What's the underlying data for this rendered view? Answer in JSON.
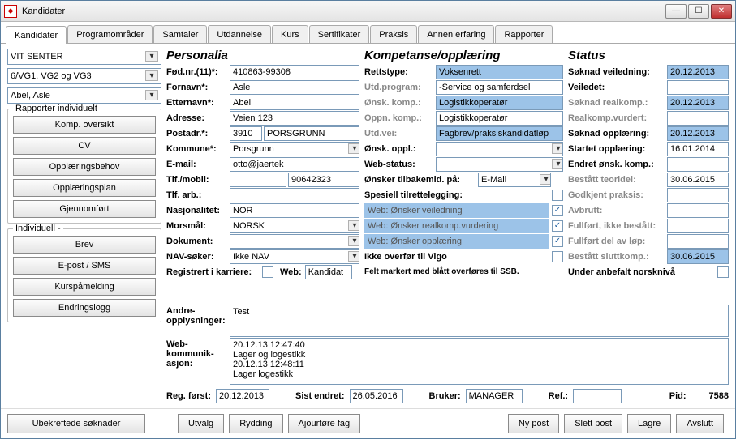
{
  "window": {
    "title": "Kandidater"
  },
  "tabs": [
    "Kandidater",
    "Programområder",
    "Samtaler",
    "Utdannelse",
    "Kurs",
    "Sertifikater",
    "Praksis",
    "Annen erfaring",
    "Rapporter"
  ],
  "active_tab": 0,
  "selectors": {
    "senter": "VIT SENTER",
    "level": "6/VG1, VG2 og VG3",
    "person": "Abel, Asle"
  },
  "group_rapporter": {
    "title": "Rapporter individuelt",
    "buttons": [
      "Komp. oversikt",
      "CV",
      "Opplæringsbehov",
      "Opplæringsplan",
      "Gjennomført"
    ]
  },
  "group_individ": {
    "title": "Individuell -",
    "buttons": [
      "Brev",
      "E-post / SMS",
      "Kurspåmelding",
      "Endringslogg"
    ]
  },
  "left_extra_btn": "Ubekreftede søknader",
  "personalia": {
    "heading": "Personalia",
    "rows": [
      {
        "label": "Fød.nr.(11)*:",
        "value": "410863-99308",
        "type": "inp"
      },
      {
        "label": "Fornavn*:",
        "value": "Asle",
        "type": "inp"
      },
      {
        "label": "Etternavn*:",
        "value": "Abel",
        "type": "inp"
      },
      {
        "label": "Adresse:",
        "value": "Veien 123",
        "type": "inp"
      },
      {
        "label": "Postadr.*:",
        "value": "3910",
        "value2": "PORSGRUNN",
        "type": "post"
      },
      {
        "label": "Kommune*:",
        "value": "Porsgrunn",
        "type": "sel"
      },
      {
        "label": "E-mail:",
        "value": "otto@jaertek",
        "type": "inp"
      },
      {
        "label": "Tlf./mobil:",
        "value": "",
        "value2": "90642323",
        "type": "tlf"
      },
      {
        "label": "Tlf. arb.:",
        "value": "",
        "type": "inp"
      },
      {
        "label": "Nasjonalitet:",
        "value": "NOR",
        "type": "inp"
      },
      {
        "label": "Morsmål:",
        "value": "NORSK",
        "type": "sel"
      },
      {
        "label": "Dokument:",
        "value": "",
        "type": "sel"
      },
      {
        "label": "NAV-søker:",
        "value": "Ikke NAV",
        "type": "sel"
      }
    ],
    "registrert_label": "Registrert i karriere:",
    "web_label": "Web:",
    "web_value": "Kandidat",
    "andre_label": "Andre-\nopplysninger:",
    "andre_value": "Test",
    "webkom_label": "Web-\nkommunik-\nasjon:",
    "webkom_value": "20.12.13 12:47:40\nLager og logestikk\n20.12.13 12:48:11\nLager logestikk",
    "reg_forst_label": "Reg. først:",
    "reg_forst": "20.12.2013",
    "sist_endret_label": "Sist endret:",
    "sist_endret": "26.05.2016",
    "bruker_label": "Bruker:",
    "bruker": "MANAGER",
    "ref_label": "Ref.:",
    "ref": "",
    "pid_label": "Pid:",
    "pid": "7588"
  },
  "kompetanse": {
    "heading": "Kompetanse/opplæring",
    "rows": [
      {
        "label": "Rettstype:",
        "value": "Voksenrett",
        "gray": false,
        "blue": true,
        "type": "txt"
      },
      {
        "label": "Utd.program:",
        "value": "-Service og samferdsel",
        "gray": true,
        "blue": false,
        "type": "txt"
      },
      {
        "label": "Ønsk. komp.:",
        "value": "Logistikkoperatør",
        "gray": true,
        "blue": true,
        "type": "txt"
      },
      {
        "label": "Oppn. komp.:",
        "value": "Logistikkoperatør",
        "gray": true,
        "blue": false,
        "type": "txt"
      },
      {
        "label": "Utd.vei:",
        "value": "Fagbrev/praksiskandidatløp",
        "gray": true,
        "blue": true,
        "type": "txt"
      },
      {
        "label": "Ønsk. oppl.:",
        "value": "",
        "gray": false,
        "blue": false,
        "type": "sel"
      },
      {
        "label": "Web-status:",
        "value": "",
        "gray": false,
        "blue": false,
        "type": "sel"
      }
    ],
    "tilbake_label": "Ønsker tilbakemld. på:",
    "tilbake_value": "E-Mail",
    "spesiell_label": "Spesiell tilrettelegging:",
    "web_rows": [
      {
        "label": "Web: Ønsker veiledning",
        "checked": true
      },
      {
        "label": "Web: Ønsker realkomp.vurdering",
        "checked": true
      },
      {
        "label": "Web: Ønsker opplæring",
        "checked": true
      }
    ],
    "vigo_label": "Ikke overfør til Vigo",
    "ssb_note": "Felt markert med blått overføres til SSB."
  },
  "status": {
    "heading": "Status",
    "rows": [
      {
        "label": "Søknad veiledning:",
        "value": "20.12.2013",
        "gray": false,
        "blue": true
      },
      {
        "label": "Veiledet:",
        "value": "",
        "gray": false,
        "blue": false
      },
      {
        "label": "Søknad realkomp.:",
        "value": "20.12.2013",
        "gray": true,
        "blue": true
      },
      {
        "label": "Realkomp.vurdert:",
        "value": "",
        "gray": true,
        "blue": false
      },
      {
        "label": "Søknad opplæring:",
        "value": "20.12.2013",
        "gray": false,
        "blue": true
      },
      {
        "label": "Startet opplæring:",
        "value": "16.01.2014",
        "gray": false,
        "blue": false
      },
      {
        "label": "Endret ønsk. komp.:",
        "value": "",
        "gray": false,
        "blue": false
      },
      {
        "label": "Bestått teoridel:",
        "value": "30.06.2015",
        "gray": true,
        "blue": false
      },
      {
        "label": "Godkjent praksis:",
        "value": "",
        "gray": true,
        "blue": false
      },
      {
        "label": "Avbrutt:",
        "value": "",
        "gray": true,
        "blue": false
      },
      {
        "label": "Fullført, ikke bestått:",
        "value": "",
        "gray": true,
        "blue": false
      },
      {
        "label": "Fullført del av løp:",
        "value": "",
        "gray": true,
        "blue": false
      },
      {
        "label": "Bestått sluttkomp.:",
        "value": "30.06.2015",
        "gray": true,
        "blue": true
      }
    ],
    "norsk_label": "Under anbefalt norsknivå"
  },
  "footer_buttons_left": [
    "Utvalg",
    "Rydding",
    "Ajourføre fag"
  ],
  "footer_buttons_right": [
    "Ny post",
    "Slett post",
    "Lagre",
    "Avslutt"
  ]
}
